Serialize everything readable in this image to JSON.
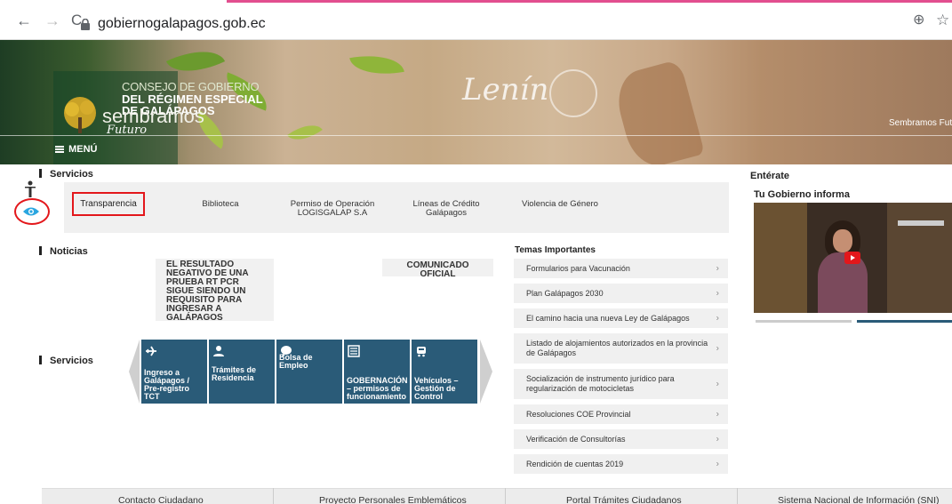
{
  "browser": {
    "url": "gobiernogalapagos.gob.ec",
    "nav": {
      "back": "←",
      "forward": "→",
      "reload": "C"
    },
    "zoom_icon": "⊕",
    "star_icon": "☆"
  },
  "banner": {
    "consejo_line1": "CONSEJO DE GOBIERNO",
    "consejo_line2": "DEL RÉGIMEN ESPECIAL",
    "consejo_line3": "DE GALÁPAGOS",
    "sembramos": "sembramos",
    "futuro": "Futuro",
    "lenin": "Lenín",
    "sembramos_right": "Sembramos Futu",
    "menu": "MENÚ"
  },
  "servicios": {
    "heading": "Servicios",
    "items": [
      "Transparencia",
      "Biblioteca",
      "Permiso de Operación LOGISGALAP S.A",
      "Líneas de Crédito Galápagos",
      "Violencia de Género"
    ]
  },
  "noticias": {
    "heading": "Noticias",
    "cards": [
      "EL RESULTADO NEGATIVO DE UNA PRUEBA RT PCR SIGUE SIENDO UN REQUISITO PARA INGRESAR A GALÁPAGOS",
      "COMUNICADO OFICIAL"
    ]
  },
  "servicios2": {
    "heading": "Servicios",
    "buttons": [
      "Ingreso a Galápagos / Pre-registro TCT",
      "Trámites de Residencia",
      "Bolsa de Empleo",
      "GOBERNACIÓN – permisos de funcionamiento",
      "Vehículos – Gestión de Control"
    ]
  },
  "temas": {
    "heading": "Temas Importantes",
    "items": [
      "Formularios para Vacunación",
      "Plan Galápagos 2030",
      "El camino hacia una nueva Ley de Galápagos",
      "Listado de alojamientos autorizados en la provincia de Galápagos",
      "Socialización de instrumento jurídico para regularización de motocicletas",
      "Resoluciones COE Provincial",
      "Verificación de Consultorías",
      "Rendición de cuentas 2019"
    ]
  },
  "right": {
    "entera": "Entérate",
    "gobierno_informa": "Tu Gobierno informa"
  },
  "footer": [
    "Contacto Ciudadano",
    "Proyecto Personales Emblemáticos",
    "Portal Trámites Ciudadanos",
    "Sistema Nacional de Información (SNI)"
  ],
  "colors": {
    "accent_red": "#e3171b",
    "button_blue": "#2a5b78",
    "panel_gray": "#f0f0f0"
  }
}
